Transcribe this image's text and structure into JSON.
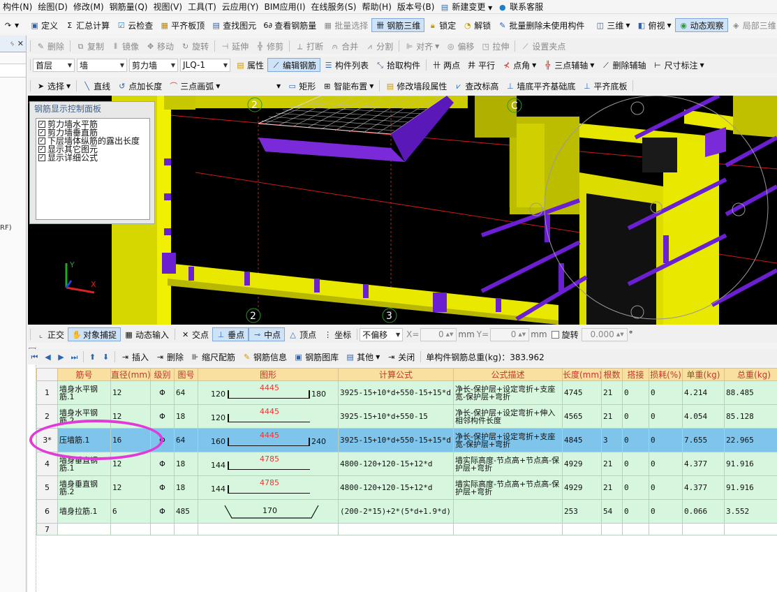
{
  "menubar": {
    "items": [
      "构件(N)",
      "绘图(D)",
      "修改(M)",
      "钢筋量(Q)",
      "视图(V)",
      "工具(T)",
      "云应用(Y)",
      "BIM应用(I)",
      "在线服务(S)",
      "帮助(H)",
      "版本号(B)",
      "新建变更",
      "联系客服"
    ]
  },
  "toolbar1": {
    "items": [
      "定义",
      "汇总计算",
      "云检查",
      "平齐板顶",
      "查找图元",
      "查看钢筋量",
      "批量选择",
      "钢筋三维",
      "锁定",
      "解锁",
      "批量删除未使用构件",
      "三维",
      "俯视",
      "动态观察",
      "局部三维"
    ],
    "active": [
      "钢筋三维",
      "动态观察"
    ]
  },
  "toolbar2": {
    "items": [
      "删除",
      "复制",
      "镜像",
      "移动",
      "旋转",
      "延伸",
      "修剪",
      "打断",
      "合并",
      "分割",
      "对齐",
      "偏移",
      "拉伸",
      "设置夹点"
    ]
  },
  "toolbar3": {
    "floor": "首层",
    "type": "墙",
    "subtype": "剪力墙",
    "element": "JLQ-1",
    "items": [
      "属性",
      "编辑钢筋",
      "构件列表",
      "拾取构件",
      "两点",
      "平行",
      "点角",
      "三点辅轴",
      "删除辅轴",
      "尺寸标注"
    ]
  },
  "toolbar4": {
    "items": [
      "选择",
      "直线",
      "点加长度",
      "三点画弧",
      "矩形",
      "智能布置",
      "修改墙段属性",
      "查改标高",
      "墙底平齐基础底",
      "平齐底板"
    ]
  },
  "control_panel": {
    "title": "钢筋显示控制面板",
    "options": [
      {
        "label": "剪力墙水平筋",
        "checked": true
      },
      {
        "label": "剪力墙垂直筋",
        "checked": true
      },
      {
        "label": "下层墙体纵筋的露出长度",
        "checked": true
      },
      {
        "label": "显示其它图元",
        "checked": true
      },
      {
        "label": "显示详细公式",
        "checked": true
      }
    ]
  },
  "viewport": {
    "axis_labels": [
      "2",
      "2",
      "3",
      "C"
    ],
    "axes": {
      "x": "X",
      "y": "Y"
    }
  },
  "snapbar": {
    "items": [
      "正交",
      "对象捕捉",
      "动态输入",
      "交点",
      "垂点",
      "中点",
      "顶点",
      "坐标"
    ],
    "active": [
      "对象捕捉",
      "垂点",
      "中点"
    ],
    "offset_mode": "不偏移",
    "x_label": "X=",
    "x_value": "0",
    "x_unit": "mm",
    "y_label": "Y=",
    "y_value": "0",
    "y_unit": "mm",
    "rotate_label": "旋转",
    "rotate_value": "0.000",
    "degree": "°"
  },
  "rebarbar": {
    "items": [
      "插入",
      "删除",
      "缩尺配筋",
      "钢筋信息",
      "钢筋图库",
      "其他",
      "关闭"
    ],
    "total_weight": "单构件钢筋总重(kg)：383.962"
  },
  "table": {
    "headers": [
      "筋号",
      "直径(mm)",
      "级别",
      "图号",
      "图形",
      "计算公式",
      "公式描述",
      "长度(mm)",
      "根数",
      "搭接",
      "损耗(%)",
      "单重(kg)",
      "总重(kg)"
    ],
    "rows": [
      {
        "num": "1",
        "name": "墙身水平钢筋.1",
        "dia": "12",
        "grade": "Φ",
        "fig": "64",
        "left": "120",
        "mid": "4445",
        "right": "180",
        "formula": "3925-15+10*d+550-15+15*d",
        "desc": "净长-保护层+设定弯折+支座宽-保护层+弯折",
        "len": "4745",
        "count": "21",
        "lap": "0",
        "loss": "0",
        "unit_w": "4.214",
        "total_w": "88.485",
        "shape": "U"
      },
      {
        "num": "2",
        "name": "墙身水平钢筋.2",
        "dia": "12",
        "grade": "Φ",
        "fig": "18",
        "left": "120",
        "mid": "4445",
        "right": "",
        "formula": "3925-15+10*d+550-15",
        "desc": "净长-保护层+设定弯折+伸入相邻构件长度",
        "len": "4565",
        "count": "21",
        "lap": "0",
        "loss": "0",
        "unit_w": "4.054",
        "total_w": "85.128",
        "shape": "L"
      },
      {
        "num": "3*",
        "name": "压墙筋.1",
        "dia": "16",
        "grade": "Φ",
        "fig": "64",
        "left": "160",
        "mid": "4445",
        "right": "240",
        "formula": "3925-15+10*d+550-15+15*d",
        "desc": "净长-保护层+设定弯折+支座宽-保护层+弯折",
        "len": "4845",
        "count": "3",
        "lap": "0",
        "loss": "0",
        "unit_w": "7.655",
        "total_w": "22.965",
        "shape": "U"
      },
      {
        "num": "4",
        "name": "墙身垂直钢筋.1",
        "dia": "12",
        "grade": "Φ",
        "fig": "18",
        "left": "144",
        "mid": "4785",
        "right": "",
        "formula": "4800-120+120-15+12*d",
        "desc": "墙实际高度-节点高+节点高-保护层+弯折",
        "len": "4929",
        "count": "21",
        "lap": "0",
        "loss": "0",
        "unit_w": "4.377",
        "total_w": "91.916",
        "shape": "L"
      },
      {
        "num": "5",
        "name": "墙身垂直钢筋.2",
        "dia": "12",
        "grade": "Φ",
        "fig": "18",
        "left": "144",
        "mid": "4785",
        "right": "",
        "formula": "4800-120+120-15+12*d",
        "desc": "墙实际高度-节点高+节点高-保护层+弯折",
        "len": "4929",
        "count": "21",
        "lap": "0",
        "loss": "0",
        "unit_w": "4.377",
        "total_w": "91.916",
        "shape": "L"
      },
      {
        "num": "6",
        "name": "墙身拉筋.1",
        "dia": "6",
        "grade": "Φ",
        "fig": "485",
        "left": "",
        "mid": "170",
        "right": "",
        "formula": "(200-2*15)+2*(5*d+1.9*d)",
        "desc": "",
        "len": "253",
        "count": "54",
        "lap": "0",
        "loss": "0",
        "unit_w": "0.066",
        "total_w": "3.552",
        "shape": "tie"
      }
    ],
    "empty_row_num": "7",
    "selected_row": "3*"
  },
  "colors": {
    "wall_yellow": "#e6e600",
    "rebar_purple": "#6a1fd0",
    "highlight_magenta": "#e13ad9",
    "row_green": "#d7f6de",
    "row_selected": "#7fc4ea",
    "header_yellow": "#f9dfa0"
  }
}
